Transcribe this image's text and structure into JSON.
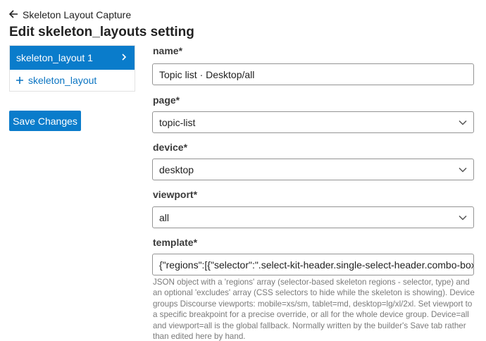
{
  "header": {
    "back_label": "Skeleton Layout Capture",
    "page_title": "Edit skeleton_layouts setting"
  },
  "sidebar": {
    "items": [
      {
        "label": "skeleton_layout 1"
      }
    ],
    "add_label": "skeleton_layout"
  },
  "actions": {
    "save_label": "Save Changes"
  },
  "form": {
    "name": {
      "label": "name*",
      "value": "Topic list · Desktop/all"
    },
    "page": {
      "label": "page*",
      "value": "topic-list"
    },
    "device": {
      "label": "device*",
      "value": "desktop"
    },
    "viewport": {
      "label": "viewport*",
      "value": "all"
    },
    "template": {
      "label": "template*",
      "value": "{\"regions\":[{\"selector\":\".select-kit-header.single-select-header.combo-box-head",
      "help": "JSON object with a 'regions' array (selector-based skeleton regions - selector, type) and an optional 'excludes' array (CSS selectors to hide while the skeleton is showing). Device groups Discourse viewports: mobile=xs/sm, tablet=md, desktop=lg/xl/2xl. Set viewport to a specific breakpoint for a precise override, or all for the whole device group. Device=all and viewport=all is the global fallback. Normally written by the builder's Save tab rather than edited here by hand."
    }
  },
  "colors": {
    "accent": "#0a7ccb",
    "border": "#949494"
  },
  "icons": {
    "back": "arrow-left-icon",
    "chevron": "chevron-right-icon",
    "plus": "plus-icon",
    "dropdown": "chevron-down-icon"
  }
}
